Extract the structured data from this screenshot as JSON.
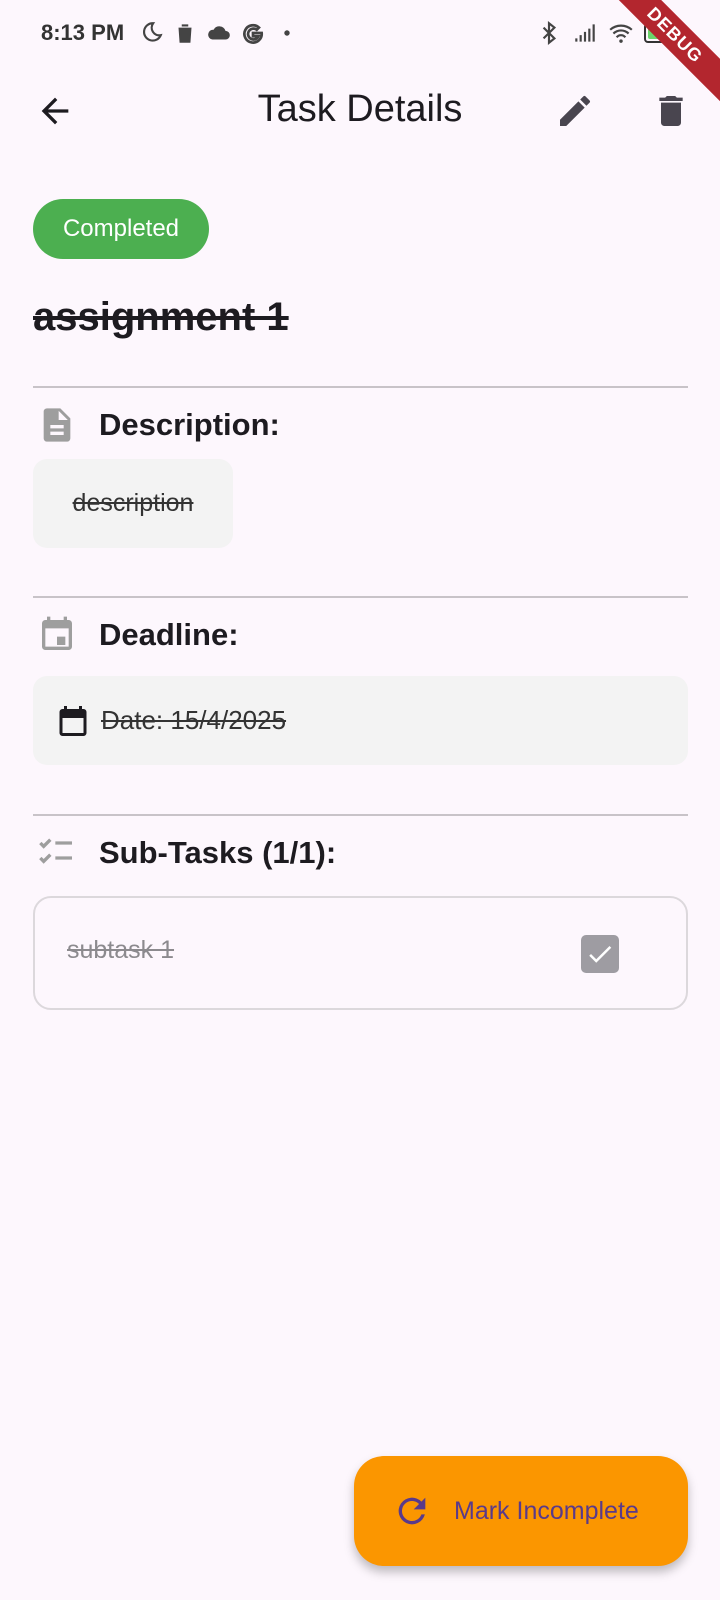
{
  "status_bar": {
    "time": "8:13 PM",
    "battery_level": "75",
    "left_icons": [
      "moon-icon",
      "trash-icon",
      "cloud-icon",
      "google-icon",
      "dot-icon"
    ],
    "right_icons": [
      "bluetooth-icon",
      "signal-icon",
      "wifi-icon",
      "battery-icon"
    ]
  },
  "debug_banner": "DEBUG",
  "app_bar": {
    "title": "Task Details",
    "back_icon": "arrow-back-icon",
    "edit_icon": "edit-icon",
    "delete_icon": "delete-icon"
  },
  "task": {
    "status": "Completed",
    "status_color": "#4caf50",
    "title": "assignment 1"
  },
  "description_section": {
    "label": "Description:",
    "icon": "document-icon",
    "text": "description"
  },
  "deadline_section": {
    "label": "Deadline:",
    "icon": "calendar-icon",
    "date_text": "Date: 15/4/2025"
  },
  "subtasks_section": {
    "label": "Sub-Tasks (1/1):",
    "icon": "checklist-icon",
    "items": [
      {
        "label": "subtask 1",
        "checked": true
      }
    ]
  },
  "fab": {
    "label": "Mark Incomplete",
    "icon": "refresh-icon",
    "color": "#fb9600"
  }
}
